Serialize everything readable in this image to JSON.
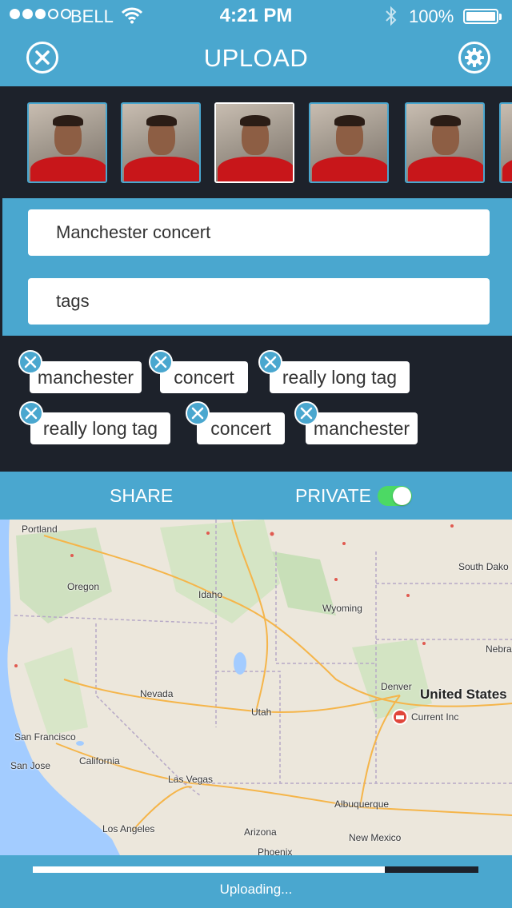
{
  "status_bar": {
    "carrier": "BELL",
    "time": "4:21 PM",
    "battery": "100%",
    "signal_bars_filled": 3,
    "signal_bars_total": 5
  },
  "nav": {
    "title": "UPLOAD",
    "close_icon": "close-circle-icon",
    "settings_icon": "gear-icon"
  },
  "thumbnails": {
    "count": 6,
    "selected_index": 2
  },
  "form": {
    "title_value": "Manchester concert",
    "tags_placeholder": "tags"
  },
  "tags": [
    "manchester",
    "concert",
    "really long tag",
    "really long tag",
    "concert",
    "manchester"
  ],
  "share_bar": {
    "share_label": "SHARE",
    "private_label": "PRIVATE",
    "private_on": true
  },
  "map": {
    "labels": [
      "Portland",
      "Oregon",
      "Idaho",
      "Wyoming",
      "South Dako",
      "Nebra",
      "Nevada",
      "Utah",
      "Denver",
      "United States",
      "Current Inc",
      "San Francisco",
      "San Jose",
      "California",
      "Las Vegas",
      "Albuquerque",
      "Los Angeles",
      "Arizona",
      "New Mexico",
      "Phoenix"
    ]
  },
  "upload": {
    "progress": 0.79,
    "status": "Uploading..."
  },
  "colors": {
    "accent": "#4aa7cf",
    "dark": "#1d222b",
    "toggle_on": "#4cd964"
  }
}
